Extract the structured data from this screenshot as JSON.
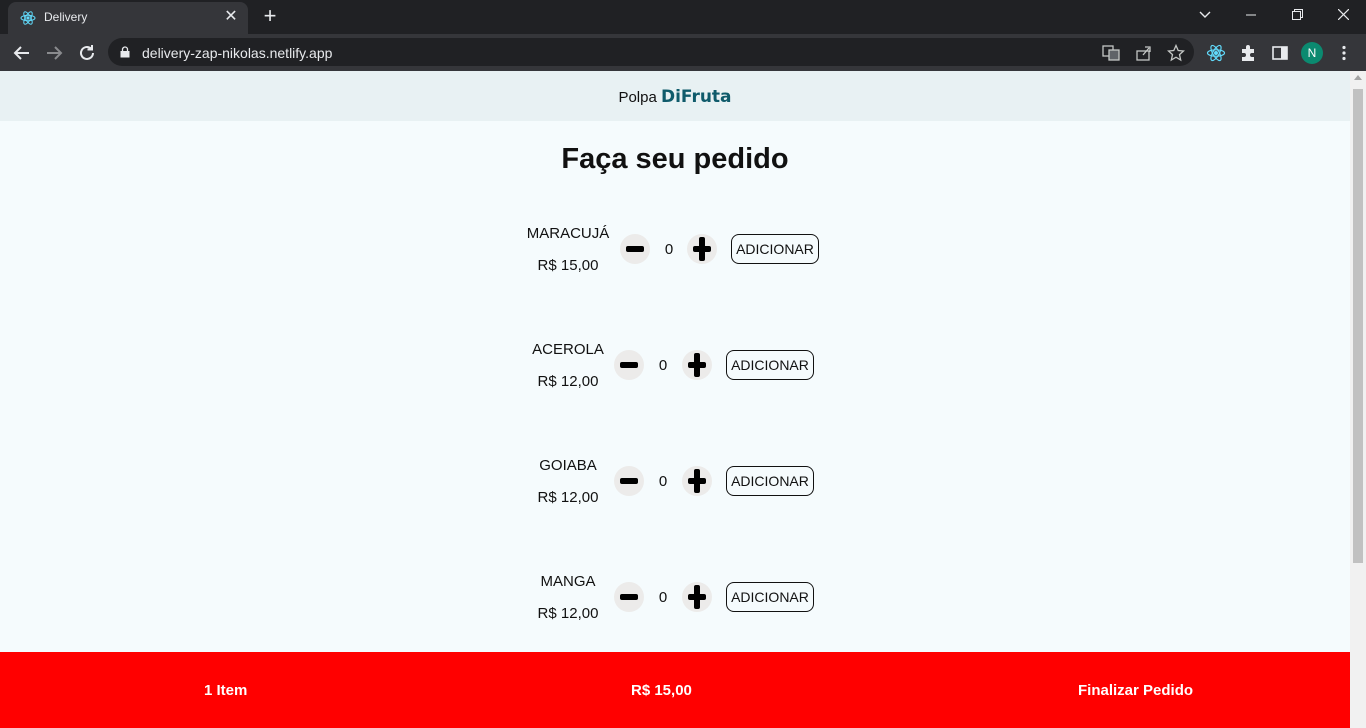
{
  "browser": {
    "tab_title": "Delivery",
    "url": "delivery-zap-nikolas.netlify.app",
    "profile_initial": "N"
  },
  "header": {
    "prefix": "Polpa",
    "brand": "DiFruta"
  },
  "page_title": "Faça seu pedido",
  "products": [
    {
      "name": "MARACUJÁ",
      "price": "R$ 15,00",
      "quantity": "0",
      "add_label": "ADICIONAR"
    },
    {
      "name": "ACEROLA",
      "price": "R$ 12,00",
      "quantity": "0",
      "add_label": "ADICIONAR"
    },
    {
      "name": "GOIABA",
      "price": "R$ 12,00",
      "quantity": "0",
      "add_label": "ADICIONAR"
    },
    {
      "name": "MANGA",
      "price": "R$ 12,00",
      "quantity": "0",
      "add_label": "ADICIONAR"
    }
  ],
  "footer": {
    "items": "1 Item",
    "total": "R$ 15,00",
    "checkout": "Finalizar Pedido"
  },
  "colors": {
    "footer_bg": "#ff0000",
    "brand": "#0f5b6b",
    "page_bg": "#f5fbfd"
  }
}
